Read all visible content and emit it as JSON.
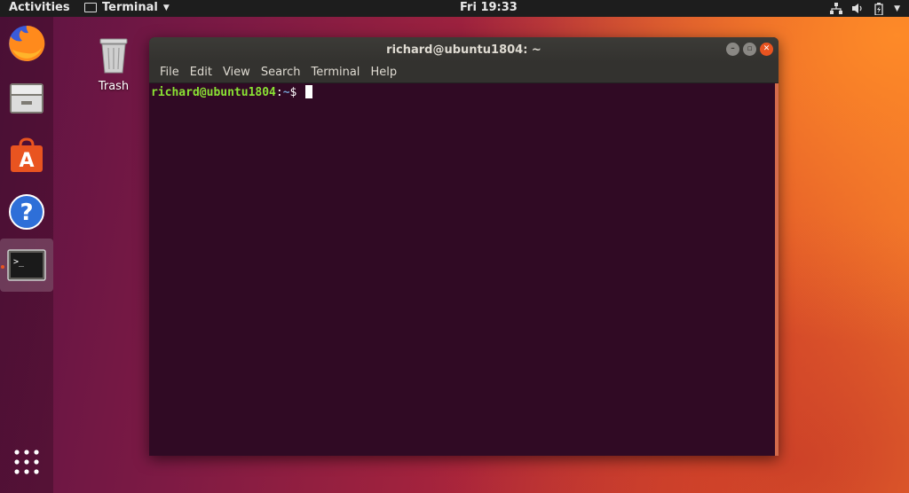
{
  "topbar": {
    "activities": "Activities",
    "app_menu": "Terminal",
    "clock": "Fri 19:33"
  },
  "dock": {
    "items": [
      {
        "name": "Firefox",
        "icon": "firefox-icon"
      },
      {
        "name": "Files",
        "icon": "files-icon"
      },
      {
        "name": "Ubuntu Software",
        "icon": "software-icon"
      },
      {
        "name": "Help",
        "icon": "help-icon"
      },
      {
        "name": "Terminal",
        "icon": "terminal-icon",
        "active": true
      },
      {
        "name": "Show Applications",
        "icon": "apps-grid-icon"
      }
    ]
  },
  "desktop": {
    "trash_label": "Trash"
  },
  "window": {
    "title": "richard@ubuntu1804: ~",
    "menu": [
      "File",
      "Edit",
      "View",
      "Search",
      "Terminal",
      "Help"
    ],
    "prompt": {
      "user_host": "richard@ubuntu1804",
      "separator": ":",
      "path": "~",
      "symbol": "$ "
    }
  },
  "colors": {
    "accent": "#e95420",
    "terminal_bg": "#300a24",
    "prompt_user": "#8ae234",
    "prompt_path": "#729fcf"
  }
}
